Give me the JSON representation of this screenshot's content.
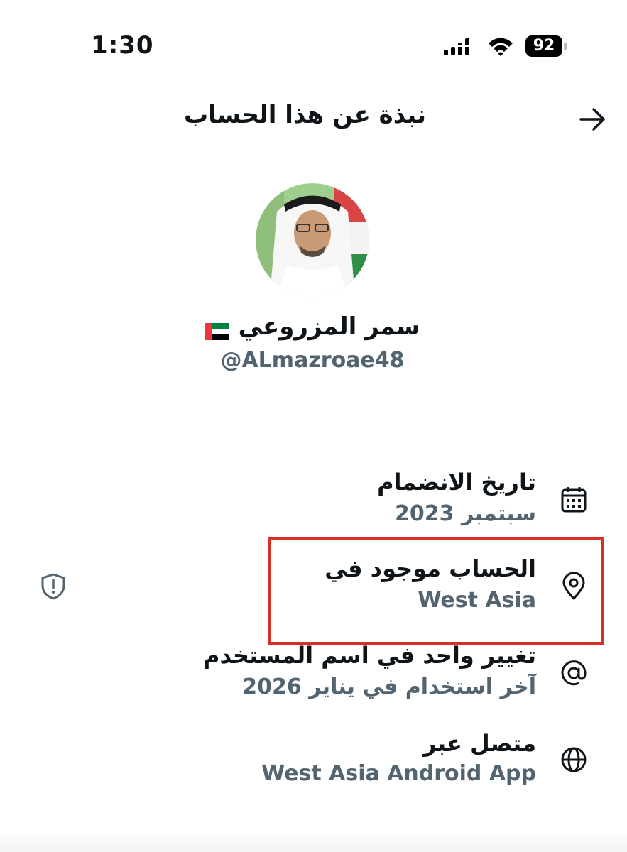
{
  "status_bar": {
    "time": "1:30",
    "battery_level": "92",
    "icons": [
      "cellular-signal-icon",
      "wifi-icon",
      "battery-icon"
    ]
  },
  "header": {
    "title": "نبذة عن هذا الحساب",
    "back_icon": "arrow-right-icon"
  },
  "profile": {
    "display_name": "سمر المزروعي",
    "flag_icon": "uae-flag-icon",
    "handle": "@ALmazroae48"
  },
  "info": {
    "joined": {
      "label": "تاريخ الانضمام",
      "value": "سبتمبر 2023",
      "icon": "calendar-icon"
    },
    "location": {
      "label": "الحساب موجود في",
      "value": "West Asia",
      "icon": "location-pin-icon"
    },
    "username_changes": {
      "label": "تغيير واحد في اسم المستخدم",
      "value": "آخر استخدام في يناير 2026",
      "icon": "at-sign-icon"
    },
    "connected_via": {
      "label": "متصل عبر",
      "value": "West Asia Android App",
      "icon": "globe-icon"
    }
  },
  "colors": {
    "text_primary": "#0f1419",
    "text_secondary": "#536471",
    "highlight_border": "#d93025"
  }
}
